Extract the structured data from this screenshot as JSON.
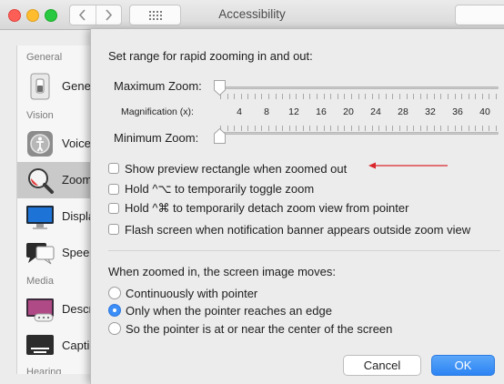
{
  "window": {
    "title": "Accessibility",
    "back_icon": "chevron-left-icon",
    "forward_icon": "chevron-right-icon",
    "grid_icon": "show-all-grid-icon"
  },
  "sidebar": {
    "sections": {
      "general": "General",
      "vision": "Vision",
      "media": "Media",
      "hearing": "Hearing"
    },
    "items": [
      {
        "label": "General",
        "icon": "general-switch-icon"
      },
      {
        "label": "VoiceOver",
        "icon": "voiceover-icon"
      },
      {
        "label": "Zoom",
        "icon": "zoom-magnifier-icon",
        "selected": true
      },
      {
        "label": "Display",
        "icon": "display-monitor-icon"
      },
      {
        "label": "Speech",
        "icon": "speech-bubble-icon"
      },
      {
        "label": "Descriptions",
        "icon": "descriptions-icon"
      },
      {
        "label": "Captions",
        "icon": "captions-icon"
      }
    ]
  },
  "sheet": {
    "range_heading": "Set range for rapid zooming in and out:",
    "max_zoom_label": "Maximum Zoom:",
    "magnification_label": "Magnification (x):",
    "magnification_ticks": [
      "4",
      "8",
      "12",
      "16",
      "20",
      "24",
      "28",
      "32",
      "36",
      "40"
    ],
    "min_zoom_label": "Minimum Zoom:",
    "max_zoom_value": 1,
    "min_zoom_value": 1,
    "checkboxes": [
      {
        "label": "Show preview rectangle when zoomed out",
        "checked": false
      },
      {
        "label": "Hold ^⌥ to temporarily toggle zoom",
        "checked": false
      },
      {
        "label": "Hold ^⌘ to temporarily detach zoom view from pointer",
        "checked": false
      },
      {
        "label": "Flash screen when notification banner appears outside zoom view",
        "checked": false
      }
    ],
    "moves_heading": "When zoomed in, the screen image moves:",
    "radios": [
      {
        "label": "Continuously with pointer",
        "selected": false
      },
      {
        "label": "Only when the pointer reaches an edge",
        "selected": true
      },
      {
        "label": "So the pointer is at or near the center of the screen",
        "selected": false
      }
    ],
    "cancel_label": "Cancel",
    "ok_label": "OK",
    "annotation_color": "#d9262b",
    "accent_color": "#2c84f3"
  }
}
